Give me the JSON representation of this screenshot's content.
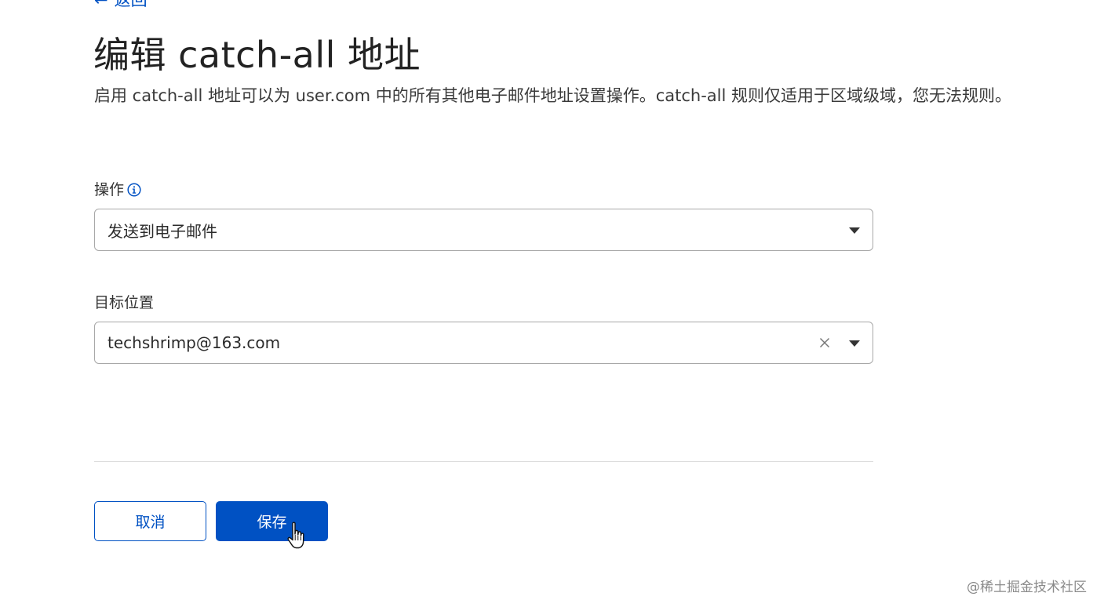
{
  "back_link": {
    "arrow": "←",
    "label": "返回"
  },
  "title": "编辑 catch-all 地址",
  "description": "启用 catch-all 地址可以为 user.com 中的所有其他电子邮件地址设置操作。catch-all 规则仅适用于区域级域，您无法规则。",
  "action_field": {
    "label": "操作",
    "info_icon": "info-icon",
    "value": "发送到电子邮件"
  },
  "destination_field": {
    "label": "目标位置",
    "value": "techshrimp@163.com"
  },
  "buttons": {
    "cancel": "取消",
    "save": "保存"
  },
  "watermark": "@稀土掘金技术社区",
  "colors": {
    "accent": "#0051c3",
    "border": "#a8a8a8",
    "divider": "#dcdcdc"
  }
}
